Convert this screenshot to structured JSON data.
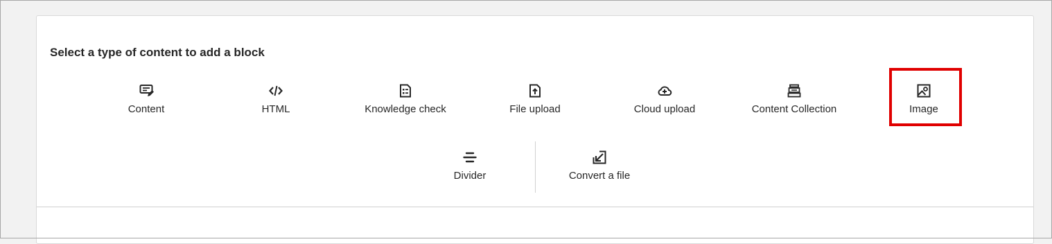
{
  "panel": {
    "title": "Select a type of content to add a block"
  },
  "options_row1": [
    {
      "label": "Content",
      "icon": "content-edit-icon"
    },
    {
      "label": "HTML",
      "icon": "code-icon"
    },
    {
      "label": "Knowledge check",
      "icon": "checklist-icon"
    },
    {
      "label": "File upload",
      "icon": "file-upload-icon"
    },
    {
      "label": "Cloud upload",
      "icon": "cloud-upload-icon"
    },
    {
      "label": "Content Collection",
      "icon": "collection-icon"
    },
    {
      "label": "Image",
      "icon": "image-icon"
    }
  ],
  "options_row2": [
    {
      "label": "Divider",
      "icon": "divider-icon"
    },
    {
      "label": "Convert a file",
      "icon": "convert-file-icon"
    }
  ],
  "highlight_color": "#e00000"
}
